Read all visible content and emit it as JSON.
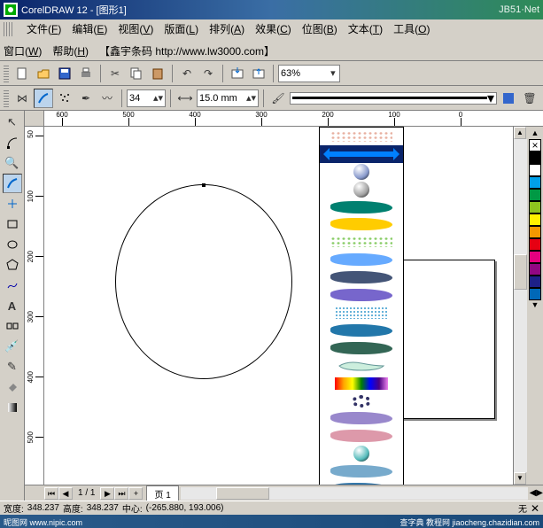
{
  "title": "CorelDRAW 12 - [图形1]",
  "watermark_tr": "JB51·Net",
  "menu": {
    "row1": [
      {
        "label": "文件",
        "accel": "F"
      },
      {
        "label": "编辑",
        "accel": "E"
      },
      {
        "label": "视图",
        "accel": "V"
      },
      {
        "label": "版面",
        "accel": "L"
      },
      {
        "label": "排列",
        "accel": "A"
      },
      {
        "label": "效果",
        "accel": "C"
      },
      {
        "label": "位图",
        "accel": "B"
      },
      {
        "label": "文本",
        "accel": "T"
      },
      {
        "label": "工具",
        "accel": "O"
      }
    ],
    "row2": [
      {
        "label": "窗口",
        "accel": "W"
      },
      {
        "label": "帮助",
        "accel": "H"
      }
    ],
    "extra": "【鑫宇条码 http://www.lw3000.com】"
  },
  "toolbar_std": {
    "zoom": "63%"
  },
  "propbar": {
    "spinner": "34",
    "width": "15.0 mm"
  },
  "ruler_h": [
    -600,
    -500,
    -400,
    -300,
    -200,
    -100,
    0
  ],
  "ruler_v": [
    50,
    100,
    200,
    300,
    400,
    500
  ],
  "ruler_unit_hint": "毫米",
  "pagenav": {
    "page_of": "1 / 1",
    "tab": "页 1"
  },
  "status": {
    "w_label": "宽度:",
    "w": "348.237",
    "h_label": "高度:",
    "h": "348.237",
    "c_label": "中心:",
    "c": "(-265.880, 193.006)",
    "fill_label": "无"
  },
  "colors": [
    "#000000",
    "#ffffff",
    "#00a0e9",
    "#009944",
    "#8fc31f",
    "#fff100",
    "#f39800",
    "#e60012",
    "#e4007f",
    "#920783",
    "#1d2088",
    "#0068b7"
  ],
  "footer": {
    "left": "昵图网 www.nipic.com",
    "right": "查字典  教程网  jiaocheng.chazidian.com"
  },
  "brushes": [
    {
      "type": "speckle",
      "c": "#e8b0a0"
    },
    {
      "type": "arrow"
    },
    {
      "type": "sphere",
      "c": "#8899cc"
    },
    {
      "type": "sphere",
      "c": "#a0a0a0"
    },
    {
      "type": "smear",
      "c": "#008070"
    },
    {
      "type": "smear",
      "c": "#ffcc00"
    },
    {
      "type": "speckle",
      "c": "#88cc66"
    },
    {
      "type": "smear",
      "c": "#66aaff"
    },
    {
      "type": "smear",
      "c": "#445577"
    },
    {
      "type": "smear",
      "c": "#7766cc"
    },
    {
      "type": "dots",
      "c": "#3399cc"
    },
    {
      "type": "smear",
      "c": "#2277aa"
    },
    {
      "type": "smear",
      "c": "#336655"
    },
    {
      "type": "whale",
      "c": "#cceedd"
    },
    {
      "type": "rainbow"
    },
    {
      "type": "ring",
      "c": "#333366"
    },
    {
      "type": "smear",
      "c": "#9988cc"
    },
    {
      "type": "smear",
      "c": "#dd99aa"
    },
    {
      "type": "sphere",
      "c": "#55bbbb"
    },
    {
      "type": "smear",
      "c": "#77aacc"
    },
    {
      "type": "smear",
      "c": "#3377aa"
    }
  ]
}
